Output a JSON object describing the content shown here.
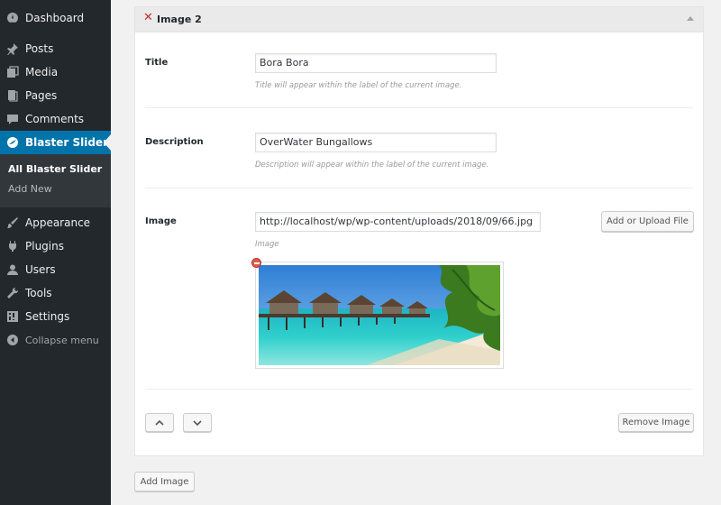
{
  "sidebar": {
    "items": [
      {
        "label": "Dashboard",
        "icon": "dashboard-icon"
      },
      {
        "label": "Posts",
        "icon": "pin-icon"
      },
      {
        "label": "Media",
        "icon": "media-icon"
      },
      {
        "label": "Pages",
        "icon": "pages-icon"
      },
      {
        "label": "Comments",
        "icon": "comment-icon"
      },
      {
        "label": "Blaster Slider",
        "icon": "slider-icon",
        "active": true
      },
      {
        "label": "Appearance",
        "icon": "brush-icon"
      },
      {
        "label": "Plugins",
        "icon": "plugin-icon"
      },
      {
        "label": "Users",
        "icon": "user-icon"
      },
      {
        "label": "Tools",
        "icon": "wrench-icon"
      },
      {
        "label": "Settings",
        "icon": "settings-icon"
      }
    ],
    "submenu": [
      {
        "label": "All Blaster Slider",
        "current": true
      },
      {
        "label": "Add New"
      }
    ],
    "collapse_label": "Collapse menu"
  },
  "panel": {
    "title": "Image 2",
    "title_field": {
      "label": "Title",
      "value": "Bora Bora",
      "hint": "Title will appear within the label of the current image."
    },
    "description_field": {
      "label": "Description",
      "value": "OverWater Bungallows",
      "hint": "Description will appear within the label of the current image."
    },
    "image_field": {
      "label": "Image",
      "value": "http://localhost/wp/wp-content/uploads/2018/09/66.jpg",
      "hint": "Image",
      "upload_label": "Add or Upload File"
    },
    "remove_label": "Remove Image"
  },
  "add_image_label": "Add Image",
  "colors": {
    "sidebar_bg": "#23282d",
    "active_bg": "#0073aa",
    "remove_red": "#c62d2d"
  }
}
